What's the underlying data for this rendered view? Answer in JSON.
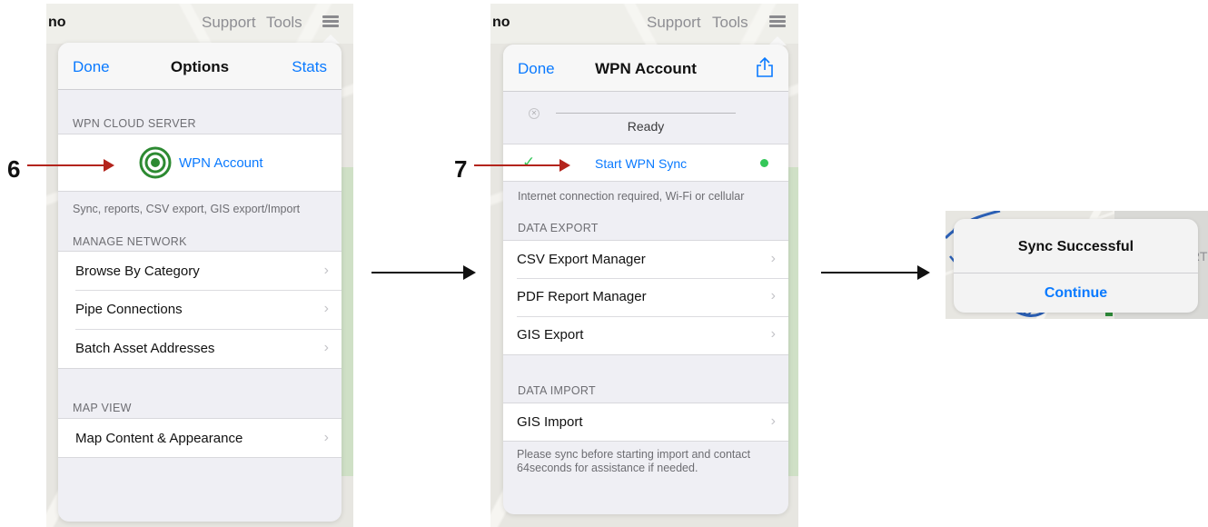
{
  "step_labels": {
    "step6": "6",
    "step7": "7"
  },
  "topbar": {
    "app_name": "no",
    "support": "Support",
    "tools": "Tools"
  },
  "screen1": {
    "nav": {
      "left": "Done",
      "title": "Options",
      "right": "Stats"
    },
    "cloud_header": "WPN CLOUD SERVER",
    "wpn_account": "WPN Account",
    "cloud_footer": "Sync, reports, CSV export, GIS export/Import",
    "manage_header": "MANAGE NETWORK",
    "manage_items": [
      "Browse By Category",
      "Pipe Connections",
      "Batch Asset Addresses"
    ],
    "map_header": "MAP VIEW",
    "map_items": [
      "Map Content & Appearance"
    ]
  },
  "screen2": {
    "nav": {
      "left": "Done",
      "title": "WPN Account",
      "right_icon": "share-icon"
    },
    "status": "Ready",
    "sync_label": "Start WPN Sync",
    "sync_status_color": "#34c759",
    "sync_note": "Internet connection required, Wi-Fi or cellular",
    "export_header": "DATA EXPORT",
    "export_items": [
      "CSV Export Manager",
      "PDF Report Manager",
      "GIS Export"
    ],
    "import_header": "DATA IMPORT",
    "import_items": [
      "GIS Import"
    ],
    "import_note": "Please sync before starting import and contact 64seconds for assistance if needed."
  },
  "alert": {
    "title": "Sync Successful",
    "button": "Continue",
    "background_text": "RT"
  },
  "colors": {
    "accent": "#0a7aff",
    "annotation_red": "#b3241c",
    "success_green": "#34c759",
    "target_green": "#2d8a32"
  }
}
